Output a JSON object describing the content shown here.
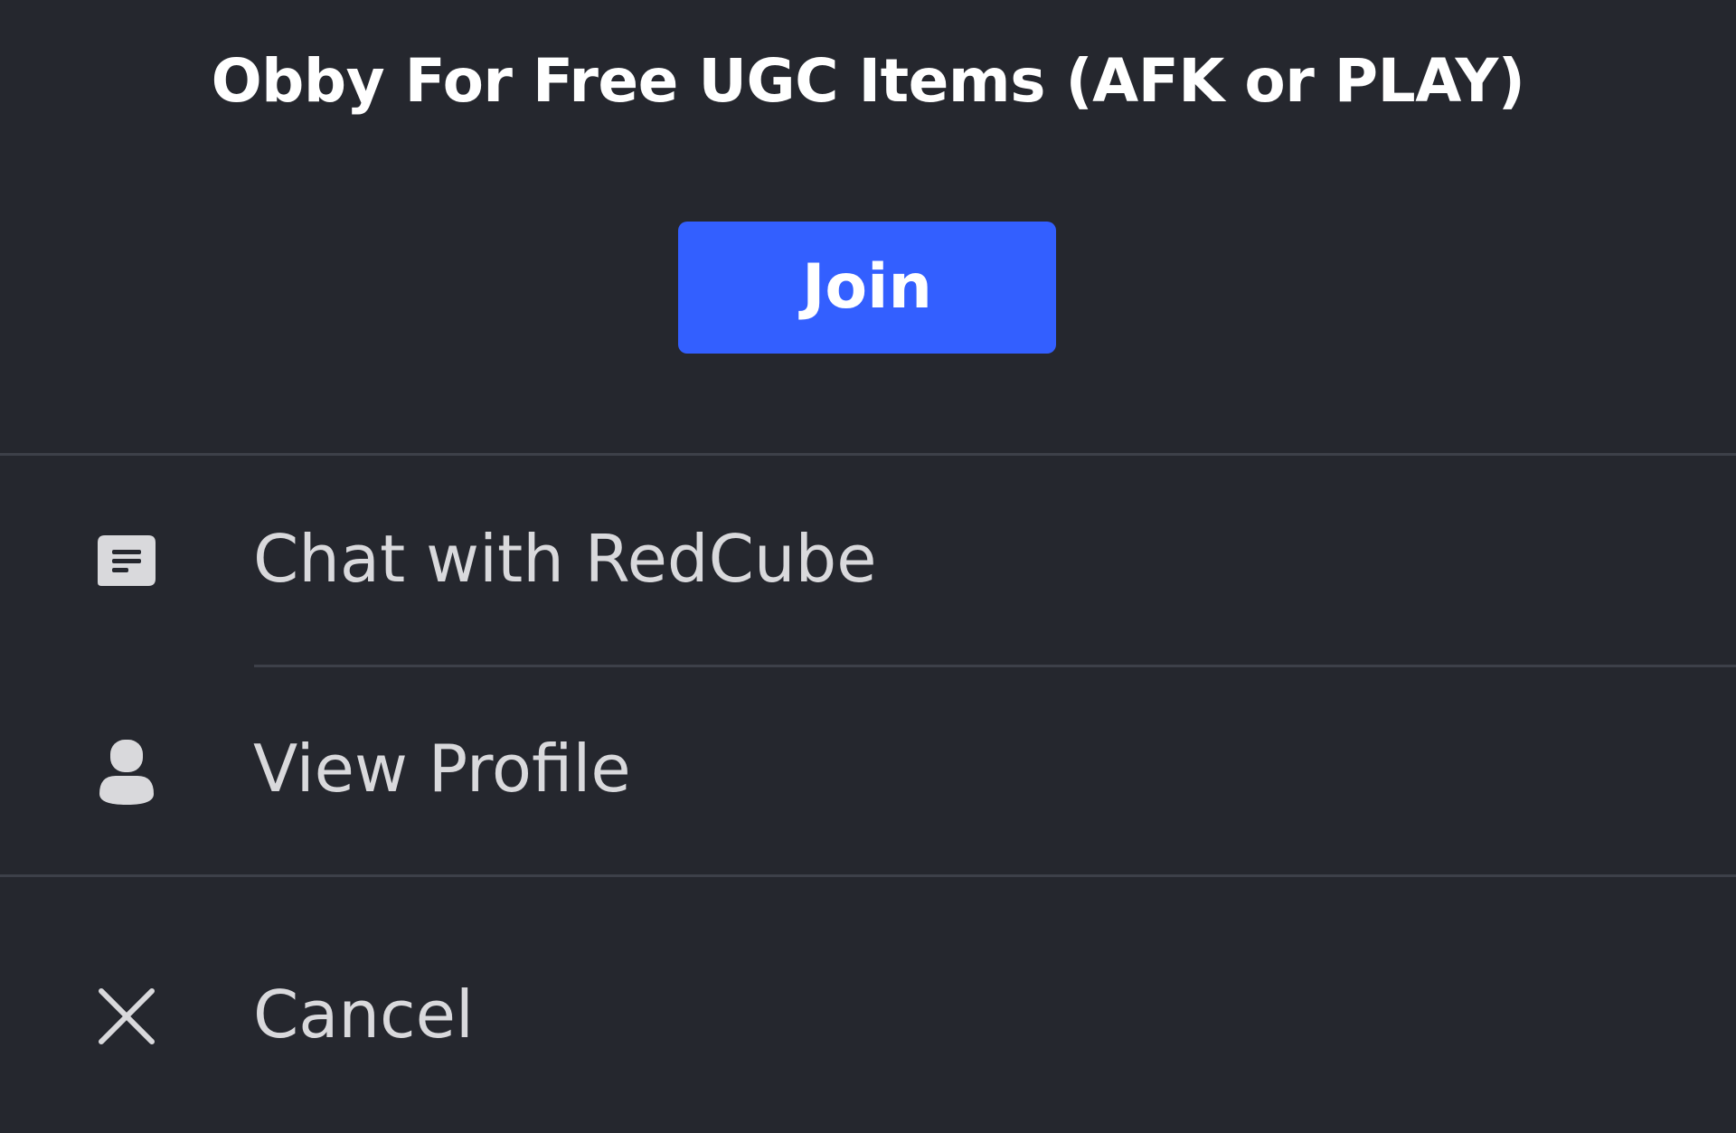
{
  "experience": {
    "title": "Obby For Free UGC Items (AFK or PLAY)"
  },
  "actions": {
    "join_label": "Join"
  },
  "menu": {
    "items": [
      {
        "label": "Chat with RedCube",
        "icon": "chat-icon"
      },
      {
        "label": "View Profile",
        "icon": "person-icon"
      },
      {
        "label": "Cancel",
        "icon": "close-icon"
      }
    ]
  },
  "colors": {
    "background": "#25272e",
    "accent": "#335fff",
    "divider": "#3d4049",
    "text_primary": "#ffffff",
    "text_secondary": "#d9d9dc"
  }
}
